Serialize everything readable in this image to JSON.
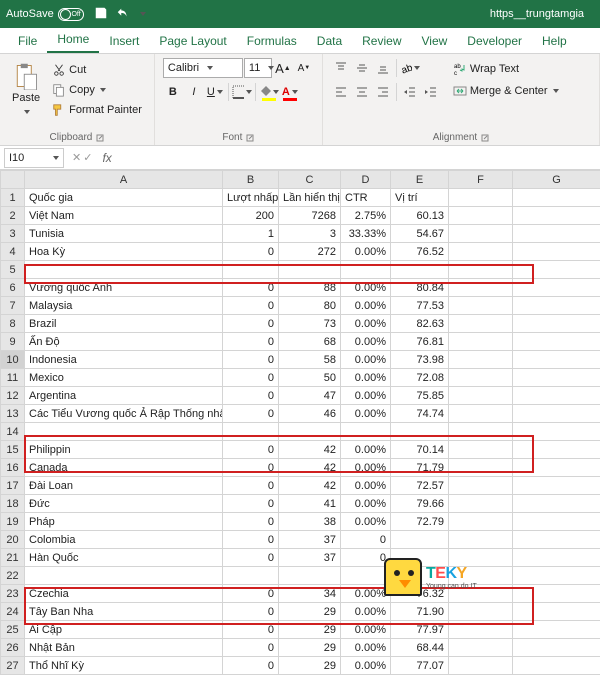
{
  "titlebar": {
    "autosave_label": "AutoSave",
    "autosave_state": "Off",
    "document_title": "https__trungtamgia"
  },
  "tabs": {
    "file": "File",
    "home": "Home",
    "insert": "Insert",
    "page_layout": "Page Layout",
    "formulas": "Formulas",
    "data": "Data",
    "review": "Review",
    "view": "View",
    "developer": "Developer",
    "help": "Help"
  },
  "ribbon": {
    "clipboard": {
      "paste": "Paste",
      "cut": "Cut",
      "copy": "Copy",
      "format_painter": "Format Painter",
      "group_label": "Clipboard"
    },
    "font": {
      "name": "Calibri",
      "size": "11",
      "increase": "A",
      "decrease": "A",
      "group_label": "Font"
    },
    "alignment": {
      "wrap_text": "Wrap Text",
      "merge_center": "Merge & Center",
      "group_label": "Alignment"
    }
  },
  "formula_bar": {
    "name_box": "I10",
    "fx_label": "fx",
    "formula": ""
  },
  "columns": [
    "A",
    "B",
    "C",
    "D",
    "E",
    "F",
    "G"
  ],
  "headers": {
    "country": "Quốc gia",
    "clicks": "Lượt nhấp",
    "impressions": "Lần hiển thị",
    "ctr": "CTR",
    "position": "Vị trí"
  },
  "rows": [
    {
      "n": 1,
      "a": "Quốc gia",
      "b": "Lượt nhấp",
      "c": "Lần hiển thị",
      "d": "CTR",
      "e": "Vị trí"
    },
    {
      "n": 2,
      "a": "Việt Nam",
      "b": "200",
      "c": "7268",
      "d": "2.75%",
      "e": "60.13"
    },
    {
      "n": 3,
      "a": "Tunisia",
      "b": "1",
      "c": "3",
      "d": "33.33%",
      "e": "54.67"
    },
    {
      "n": 4,
      "a": "Hoa Kỳ",
      "b": "0",
      "c": "272",
      "d": "0.00%",
      "e": "76.52"
    },
    {
      "n": 5,
      "a": "",
      "b": "",
      "c": "",
      "d": "",
      "e": ""
    },
    {
      "n": 6,
      "a": "Vương quốc Anh",
      "b": "0",
      "c": "88",
      "d": "0.00%",
      "e": "80.84"
    },
    {
      "n": 7,
      "a": "Malaysia",
      "b": "0",
      "c": "80",
      "d": "0.00%",
      "e": "77.53"
    },
    {
      "n": 8,
      "a": "Brazil",
      "b": "0",
      "c": "73",
      "d": "0.00%",
      "e": "82.63"
    },
    {
      "n": 9,
      "a": "Ấn Độ",
      "b": "0",
      "c": "68",
      "d": "0.00%",
      "e": "76.81"
    },
    {
      "n": 10,
      "a": "Indonesia",
      "b": "0",
      "c": "58",
      "d": "0.00%",
      "e": "73.98"
    },
    {
      "n": 11,
      "a": "Mexico",
      "b": "0",
      "c": "50",
      "d": "0.00%",
      "e": "72.08"
    },
    {
      "n": 12,
      "a": "Argentina",
      "b": "0",
      "c": "47",
      "d": "0.00%",
      "e": "75.85"
    },
    {
      "n": 13,
      "a": "Các Tiểu Vương quốc Ả Rập Thống nhất",
      "b": "0",
      "c": "46",
      "d": "0.00%",
      "e": "74.74"
    },
    {
      "n": 14,
      "a": "",
      "b": "",
      "c": "",
      "d": "",
      "e": ""
    },
    {
      "n": 15,
      "a": "Philippin",
      "b": "0",
      "c": "42",
      "d": "0.00%",
      "e": "70.14"
    },
    {
      "n": 16,
      "a": "Canada",
      "b": "0",
      "c": "42",
      "d": "0.00%",
      "e": "71.79"
    },
    {
      "n": 17,
      "a": "Đài Loan",
      "b": "0",
      "c": "42",
      "d": "0.00%",
      "e": "72.57"
    },
    {
      "n": 18,
      "a": "Đức",
      "b": "0",
      "c": "41",
      "d": "0.00%",
      "e": "79.66"
    },
    {
      "n": 19,
      "a": "Pháp",
      "b": "0",
      "c": "38",
      "d": "0.00%",
      "e": "72.79"
    },
    {
      "n": 20,
      "a": "Colombia",
      "b": "0",
      "c": "37",
      "d": "0",
      "e": ""
    },
    {
      "n": 21,
      "a": "Hàn Quốc",
      "b": "0",
      "c": "37",
      "d": "0",
      "e": ""
    },
    {
      "n": 22,
      "a": "",
      "b": "",
      "c": "",
      "d": "",
      "e": ""
    },
    {
      "n": 23,
      "a": "Czechia",
      "b": "0",
      "c": "34",
      "d": "0.00%",
      "e": "76.32"
    },
    {
      "n": 24,
      "a": "Tây Ban Nha",
      "b": "0",
      "c": "29",
      "d": "0.00%",
      "e": "71.90"
    },
    {
      "n": 25,
      "a": "Ai Cập",
      "b": "0",
      "c": "29",
      "d": "0.00%",
      "e": "77.97"
    },
    {
      "n": 26,
      "a": "Nhật Bản",
      "b": "0",
      "c": "29",
      "d": "0.00%",
      "e": "68.44"
    },
    {
      "n": 27,
      "a": "Thổ Nhĩ Kỳ",
      "b": "0",
      "c": "29",
      "d": "0.00%",
      "e": "77.07"
    }
  ],
  "logo": {
    "brand_t": "T",
    "brand_e": "E",
    "brand_k": "K",
    "brand_y": "Y",
    "tagline": "Young can do IT"
  }
}
